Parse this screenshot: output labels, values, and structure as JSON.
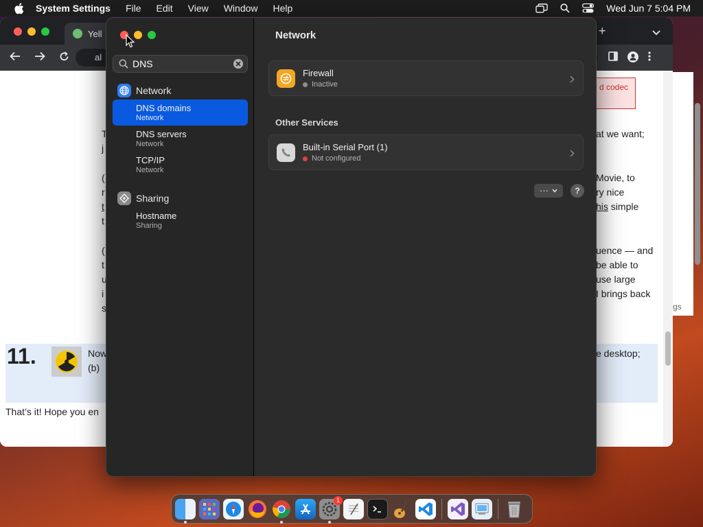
{
  "menubar": {
    "app_name": "System Settings",
    "menus": [
      "File",
      "Edit",
      "View",
      "Window",
      "Help"
    ],
    "clock": "Wed Jun 7  5:04 PM"
  },
  "browser": {
    "tab_title": "Yell",
    "omnibox_text": "al",
    "codec_text": "d codec",
    "right_lines": [
      "at we want;",
      "Movie, to",
      "ry nice",
      "his simple",
      "uence — and",
      "be able to",
      "use large",
      "I brings back"
    ],
    "right_link": "his",
    "left_chars": [
      "T",
      "j",
      "(",
      "r",
      "t",
      "t",
      "(",
      "t",
      "u",
      "i",
      "s"
    ],
    "step_number": "11.",
    "step_line1": "Now",
    "step_line2": "(b)",
    "step_right": "e desktop;",
    "footer_text": "That’s it! Hope you en",
    "strip_text": "gs"
  },
  "settings": {
    "search": {
      "value": "DNS",
      "placeholder": "Search"
    },
    "sidebar": {
      "groups": [
        {
          "label": "Network",
          "items": [
            {
              "title": "DNS domains",
              "subtitle": "Network",
              "selected": true
            },
            {
              "title": "DNS servers",
              "subtitle": "Network",
              "selected": false
            },
            {
              "title": "TCP/IP",
              "subtitle": "Network",
              "selected": false
            }
          ]
        },
        {
          "label": "Sharing",
          "items": [
            {
              "title": "Hostname",
              "subtitle": "Sharing",
              "selected": false
            }
          ]
        }
      ]
    },
    "content": {
      "title": "Network",
      "firewall": {
        "name": "Firewall",
        "status": "Inactive",
        "status_color": "#8e8e8e"
      },
      "other_services_label": "Other Services",
      "serial": {
        "name": "Built-in Serial Port (1)",
        "status": "Not configured",
        "status_color": "#e0443a"
      },
      "more_label": "···",
      "help_label": "?"
    }
  },
  "colors": {
    "accent": "#0a5ae0",
    "firewall_icon": "#f5a623",
    "network_icon": "#2f7cf6",
    "sharing_icon": "#8a8a8a"
  },
  "dock": {
    "apps": [
      "finder-icon",
      "launchpad-icon",
      "safari-icon",
      "firefox-icon",
      "chrome-icon",
      "app-store-icon",
      "system-settings-icon",
      "textedit-icon",
      "terminal-icon",
      "garageband-icon",
      "vscode-icon",
      "visual-studio-icon",
      "preview-icon",
      "trash-icon"
    ],
    "settings_badge": "1"
  }
}
